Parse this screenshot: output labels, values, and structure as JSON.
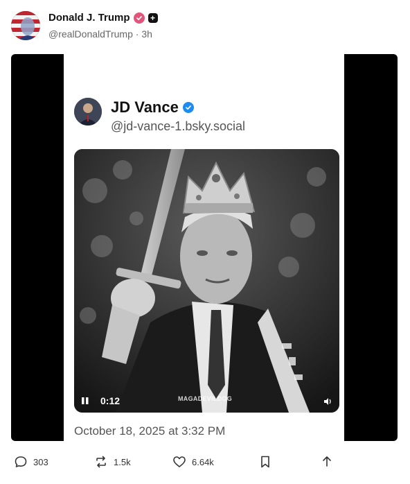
{
  "post": {
    "author_name": "Donald J. Trump",
    "author_handle": "@realDonaldTrump",
    "time_separator": "·",
    "time_ago": "3h",
    "plus_badge": "+"
  },
  "embedded": {
    "author_name": "JD Vance",
    "author_handle": "@jd-vance-1.bsky.social",
    "video_time": "0:12",
    "watermark": "MAGADEVILDOG",
    "date": "October 18, 2025 at 3:32 PM"
  },
  "actions": {
    "replies": "303",
    "reposts": "1.5k",
    "likes": "6.64k"
  },
  "colors": {
    "verified_pink": "#e2547a",
    "verified_blue": "#1d8cf0",
    "media_bg": "#000000"
  },
  "icons": [
    "reply-icon",
    "repost-icon",
    "like-icon",
    "bookmark-icon",
    "share-icon",
    "pause-icon",
    "speaker-icon"
  ]
}
